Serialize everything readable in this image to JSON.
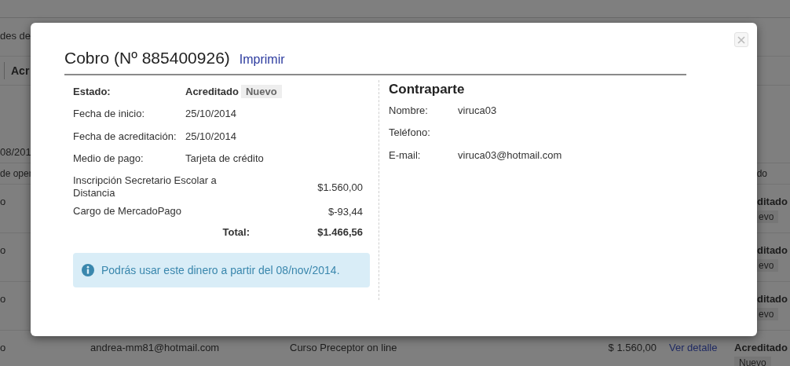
{
  "background": {
    "header_text": "des de",
    "tab": "Acr",
    "date": "08/201",
    "column_header": "de oper",
    "column_header_right": "do",
    "rows": [
      {
        "col_1": "o",
        "status": "ditado",
        "badge": "evo"
      },
      {
        "col_1": "o",
        "status": "ditado",
        "badge": "evo"
      },
      {
        "col_1": "o",
        "status": "ditado",
        "badge": "evo"
      },
      {
        "col_1": "o",
        "email": "andrea-mm81@hotmail.com",
        "description": "Curso Preceptor on line",
        "amount": "$ 1.560,00",
        "link": "Ver detalle",
        "status": "Acreditado",
        "badge": "Nuevo"
      }
    ]
  },
  "modal": {
    "title": "Cobro (Nº 885400926)",
    "print_link": "Imprimir",
    "status": {
      "label": "Estado:",
      "value": "Acreditado",
      "badge": "Nuevo"
    },
    "fields": [
      {
        "label": "Fecha de inicio:",
        "value": "25/10/2014"
      },
      {
        "label": "Fecha de acreditación:",
        "value": "25/10/2014"
      },
      {
        "label": "Medio de pago:",
        "value": "Tarjeta de crédito"
      }
    ],
    "items": [
      {
        "description": "Inscripción Secretario Escolar a Distancia",
        "amount": "$1.560,00"
      },
      {
        "description": "Cargo de MercadoPago",
        "amount": "$-93,44"
      }
    ],
    "total": {
      "label": "Total:",
      "amount": "$1.466,56"
    },
    "alert": "Podrás usar este dinero a partir del 08/nov/2014.",
    "counterpart": {
      "title": "Contraparte",
      "fields": [
        {
          "label": "Nombre:",
          "value": "viruca03"
        },
        {
          "label": "Teléfono:"
        },
        {
          "label": "E-mail:",
          "value": "viruca03@hotmail.com"
        }
      ]
    }
  }
}
